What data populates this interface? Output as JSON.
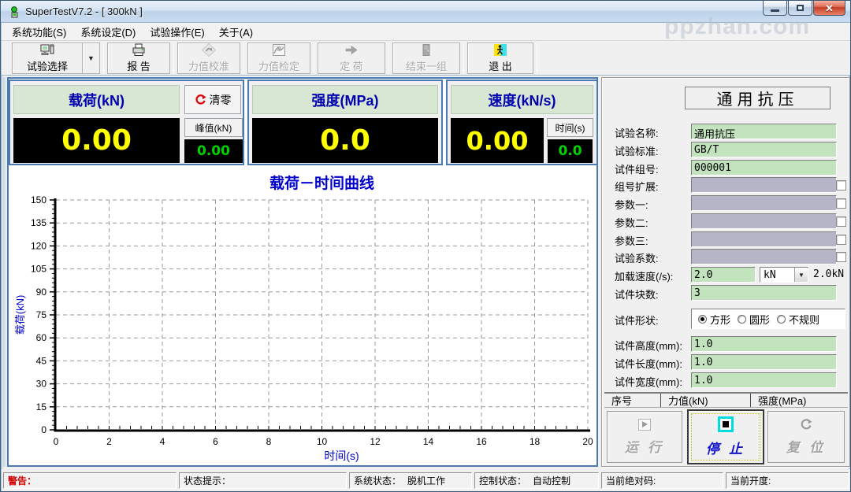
{
  "window": {
    "title": "SuperTestV7.2 - [ 300kN ]",
    "watermark": "ppzhan.com",
    "buttons": {
      "minimize": "minimize",
      "maximize": "maximize",
      "close": "close"
    }
  },
  "menu": {
    "items": [
      "系统功能(S)",
      "系统设定(D)",
      "试验操作(E)",
      "关于(A)"
    ]
  },
  "toolbar": {
    "buttons": [
      {
        "label": "试验选择",
        "icon": "computer-icon",
        "enabled": true,
        "dropdown": true
      },
      {
        "label": "报 告",
        "icon": "printer-icon",
        "enabled": true,
        "dropdown": false
      },
      {
        "label": "力值校准",
        "icon": "calibrate-icon",
        "enabled": false,
        "dropdown": false
      },
      {
        "label": "力值检定",
        "icon": "verify-icon",
        "enabled": false,
        "dropdown": false
      },
      {
        "label": "定 荷",
        "icon": "load-arrow-icon",
        "enabled": false,
        "dropdown": false
      },
      {
        "label": "结束一组",
        "icon": "door-icon",
        "enabled": false,
        "dropdown": false
      },
      {
        "label": "退 出",
        "icon": "exit-icon",
        "enabled": true,
        "dropdown": false
      }
    ]
  },
  "displays": {
    "load": {
      "title": "载荷(kN)",
      "value": "0.00",
      "clear_label": "清零",
      "peak_label": "峰值(kN)",
      "peak_value": "0.00"
    },
    "strength": {
      "title": "强度(MPa)",
      "value": "0.0"
    },
    "speed": {
      "title": "速度(kN/s)",
      "value": "0.00",
      "time_label": "时间(s)",
      "time_value": "0.0"
    }
  },
  "chart_data": {
    "type": "line",
    "title": "载荷－时间曲线",
    "xlabel": "时间(s)",
    "ylabel": "载荷(kN)",
    "xlim": [
      0,
      20
    ],
    "ylim": [
      0,
      150
    ],
    "xticks": [
      0,
      2,
      4,
      6,
      8,
      10,
      12,
      14,
      16,
      18,
      20
    ],
    "yticks": [
      0,
      15,
      30,
      45,
      60,
      75,
      90,
      105,
      120,
      135,
      150
    ],
    "grid": true,
    "series": []
  },
  "params": {
    "title": "通用抗压",
    "fields_top": [
      {
        "label": "试验名称:",
        "value": "通用抗压",
        "style": "green",
        "checkbox": false
      },
      {
        "label": "试验标准:",
        "value": "GB/T",
        "style": "green",
        "checkbox": false
      },
      {
        "label": "试件组号:",
        "value": "000001",
        "style": "green",
        "checkbox": false
      },
      {
        "label": "组号扩展:",
        "value": "",
        "style": "gray",
        "checkbox": true
      },
      {
        "label": "参数一:",
        "value": "",
        "style": "gray",
        "checkbox": true
      },
      {
        "label": "参数二:",
        "value": "",
        "style": "gray",
        "checkbox": true
      },
      {
        "label": "参数三:",
        "value": "",
        "style": "gray",
        "checkbox": true
      },
      {
        "label": "试验系数:",
        "value": "",
        "style": "gray",
        "checkbox": true
      }
    ],
    "speed": {
      "label": "加载速度(/s):",
      "value": "2.0",
      "unit": "kN",
      "resolved": "2.0kN"
    },
    "count": {
      "label": "试件块数:",
      "value": "3"
    },
    "shape": {
      "label": "试件形状:",
      "options": [
        "方形",
        "圆形",
        "不规则"
      ],
      "selected": "方形"
    },
    "dims": [
      {
        "label": "试件高度(mm):",
        "value": "1.0"
      },
      {
        "label": "试件长度(mm):",
        "value": "1.0"
      },
      {
        "label": "试件宽度(mm):",
        "value": "1.0"
      }
    ]
  },
  "result_table": {
    "headers": [
      "序号",
      "力值(kN)",
      "强度(MPa)"
    ]
  },
  "controls": {
    "run": {
      "label": "运 行",
      "enabled": false
    },
    "stop": {
      "label": "停 止",
      "enabled": true
    },
    "reset": {
      "label": "复 位",
      "enabled": false
    }
  },
  "statusbar": {
    "segments": [
      {
        "label": "警告：",
        "value": "",
        "warn": true
      },
      {
        "label": "状态提示：",
        "value": "",
        "warn": false
      },
      {
        "label": "系统状态：",
        "value": "脱机工作",
        "warn": false
      },
      {
        "label": "控制状态：",
        "value": "自动控制",
        "warn": false
      },
      {
        "label": "当前绝对码:",
        "value": "",
        "warn": false
      },
      {
        "label": "当前开度:",
        "value": "",
        "warn": false
      }
    ]
  },
  "colors": {
    "accent_border": "#4a7ab5",
    "display_header_bg": "#d7e7d3",
    "display_header_text": "#0000b0",
    "digit_yellow": "#ffff00",
    "digit_green": "#00d400",
    "input_green": "#c2e3be",
    "input_gray": "#b5b5c7",
    "chart_blue": "#0000cc",
    "stop_blue": "#1414cc",
    "warn_red": "#d00000"
  }
}
